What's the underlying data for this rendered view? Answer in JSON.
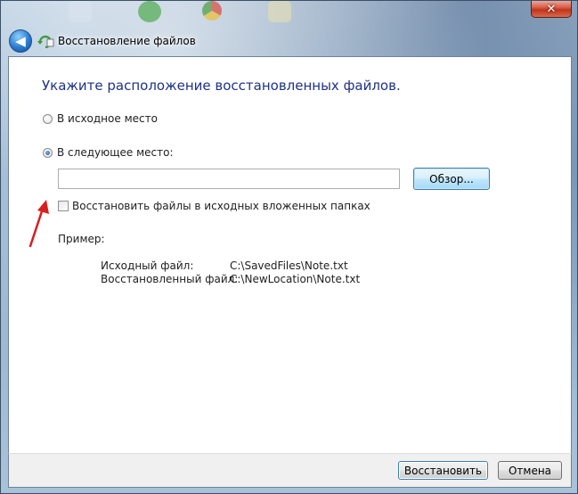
{
  "window": {
    "title": "Восстановление файлов",
    "close_glyph": "✕",
    "back_glyph": "◀"
  },
  "main": {
    "heading": "Укажите расположение восстановленных файлов.",
    "option_original": {
      "label": "В исходное место",
      "checked": false
    },
    "option_other": {
      "label": "В следующее место:",
      "checked": true
    },
    "path_input": {
      "value": "",
      "placeholder": ""
    },
    "browse_label": "Обзор...",
    "preserve_folders": {
      "label": "Восстановить файлы в исходных вложенных папках",
      "checked": false
    },
    "example": {
      "label": "Пример:",
      "rows": [
        {
          "name": "Исходный файл:",
          "value": "C:\\SavedFiles\\Note.txt"
        },
        {
          "name": "Восстановленный файл:",
          "value": "C:\\NewLocation\\Note.txt"
        }
      ]
    }
  },
  "footer": {
    "restore_label": "Восстановить",
    "cancel_label": "Отмена"
  },
  "colors": {
    "heading": "#1e3287",
    "annotation_arrow": "#d81e1e",
    "accent_border": "#3c7fb1"
  },
  "icons": {
    "back": "back-arrow-icon",
    "title": "restore-files-icon",
    "close": "close-icon",
    "annotation": "red-arrow-annotation-icon"
  }
}
